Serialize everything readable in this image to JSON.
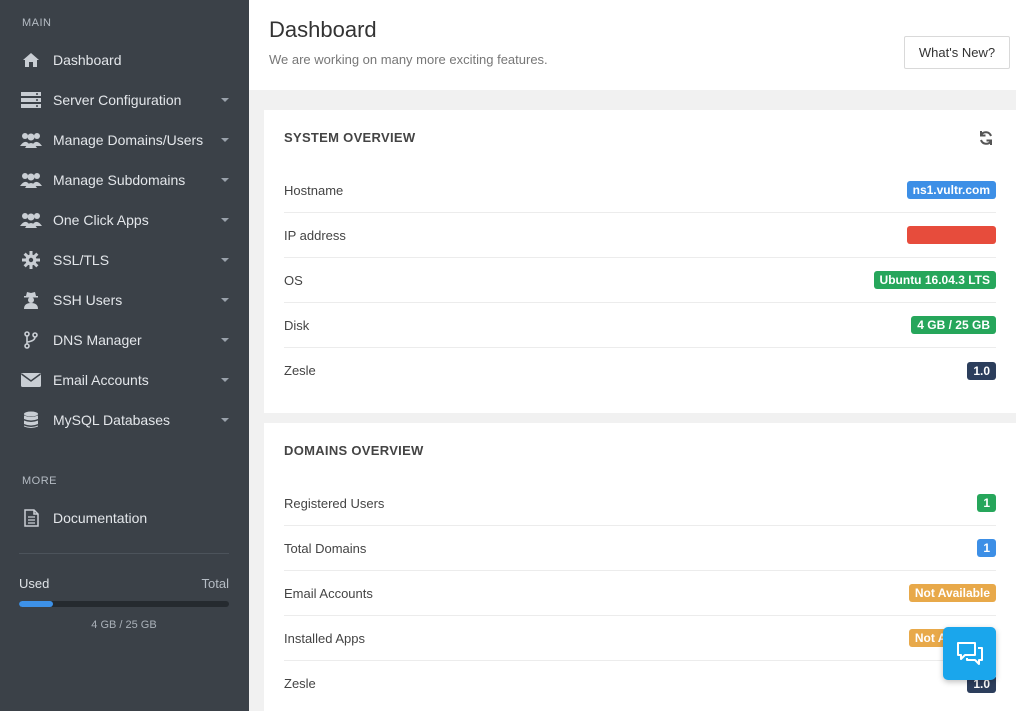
{
  "sidebar": {
    "main_label": "MAIN",
    "more_label": "MORE",
    "items": [
      {
        "label": "Dashboard",
        "icon": "home-icon",
        "caret": false
      },
      {
        "label": "Server Configuration",
        "icon": "server-icon",
        "caret": true
      },
      {
        "label": "Manage Domains/Users",
        "icon": "users-icon",
        "caret": true
      },
      {
        "label": "Manage Subdomains",
        "icon": "users-icon",
        "caret": true
      },
      {
        "label": "One Click Apps",
        "icon": "users-icon",
        "caret": true
      },
      {
        "label": "SSL/TLS",
        "icon": "gear-icon",
        "caret": true
      },
      {
        "label": "SSH Users",
        "icon": "user-secret-icon",
        "caret": true
      },
      {
        "label": "DNS Manager",
        "icon": "branch-icon",
        "caret": true
      },
      {
        "label": "Email Accounts",
        "icon": "envelope-icon",
        "caret": true
      },
      {
        "label": "MySQL Databases",
        "icon": "database-icon",
        "caret": true
      }
    ],
    "documentation": {
      "label": "Documentation",
      "icon": "document-icon"
    },
    "usage": {
      "used_label": "Used",
      "total_label": "Total",
      "text": "4 GB / 25 GB",
      "fraction": 0.16
    }
  },
  "header": {
    "title": "Dashboard",
    "subtitle": "We are working on many more exciting features.",
    "whats_new": "What's New?"
  },
  "system_overview": {
    "title": "SYSTEM OVERVIEW",
    "rows": [
      {
        "label": "Hostname",
        "value": "ns1.vultr.com",
        "color": "#3d8fe6"
      },
      {
        "label": "IP address",
        "value": "",
        "color": "#e74c3c"
      },
      {
        "label": "OS",
        "value": "Ubuntu 16.04.3 LTS",
        "color": "#26a65b"
      },
      {
        "label": "Disk",
        "value": "4 GB / 25 GB",
        "color": "#26a65b"
      },
      {
        "label": "Zesle",
        "value": "1.0",
        "color": "#2c3e5c"
      }
    ]
  },
  "domains_overview": {
    "title": "DOMAINS OVERVIEW",
    "rows": [
      {
        "label": "Registered Users",
        "value": "1",
        "color": "#26a65b"
      },
      {
        "label": "Total Domains",
        "value": "1",
        "color": "#3d8fe6"
      },
      {
        "label": "Email Accounts",
        "value": "Not Available",
        "color": "#e8a94a"
      },
      {
        "label": "Installed Apps",
        "value": "Not Available",
        "color": "#e8a94a"
      },
      {
        "label": "Zesle",
        "value": "1.0",
        "color": "#2c3e5c"
      }
    ]
  },
  "colors": {
    "sidebar_bg": "#3b4148",
    "accent_blue": "#3d8fe6",
    "chat_bg": "#1aa6ec"
  }
}
